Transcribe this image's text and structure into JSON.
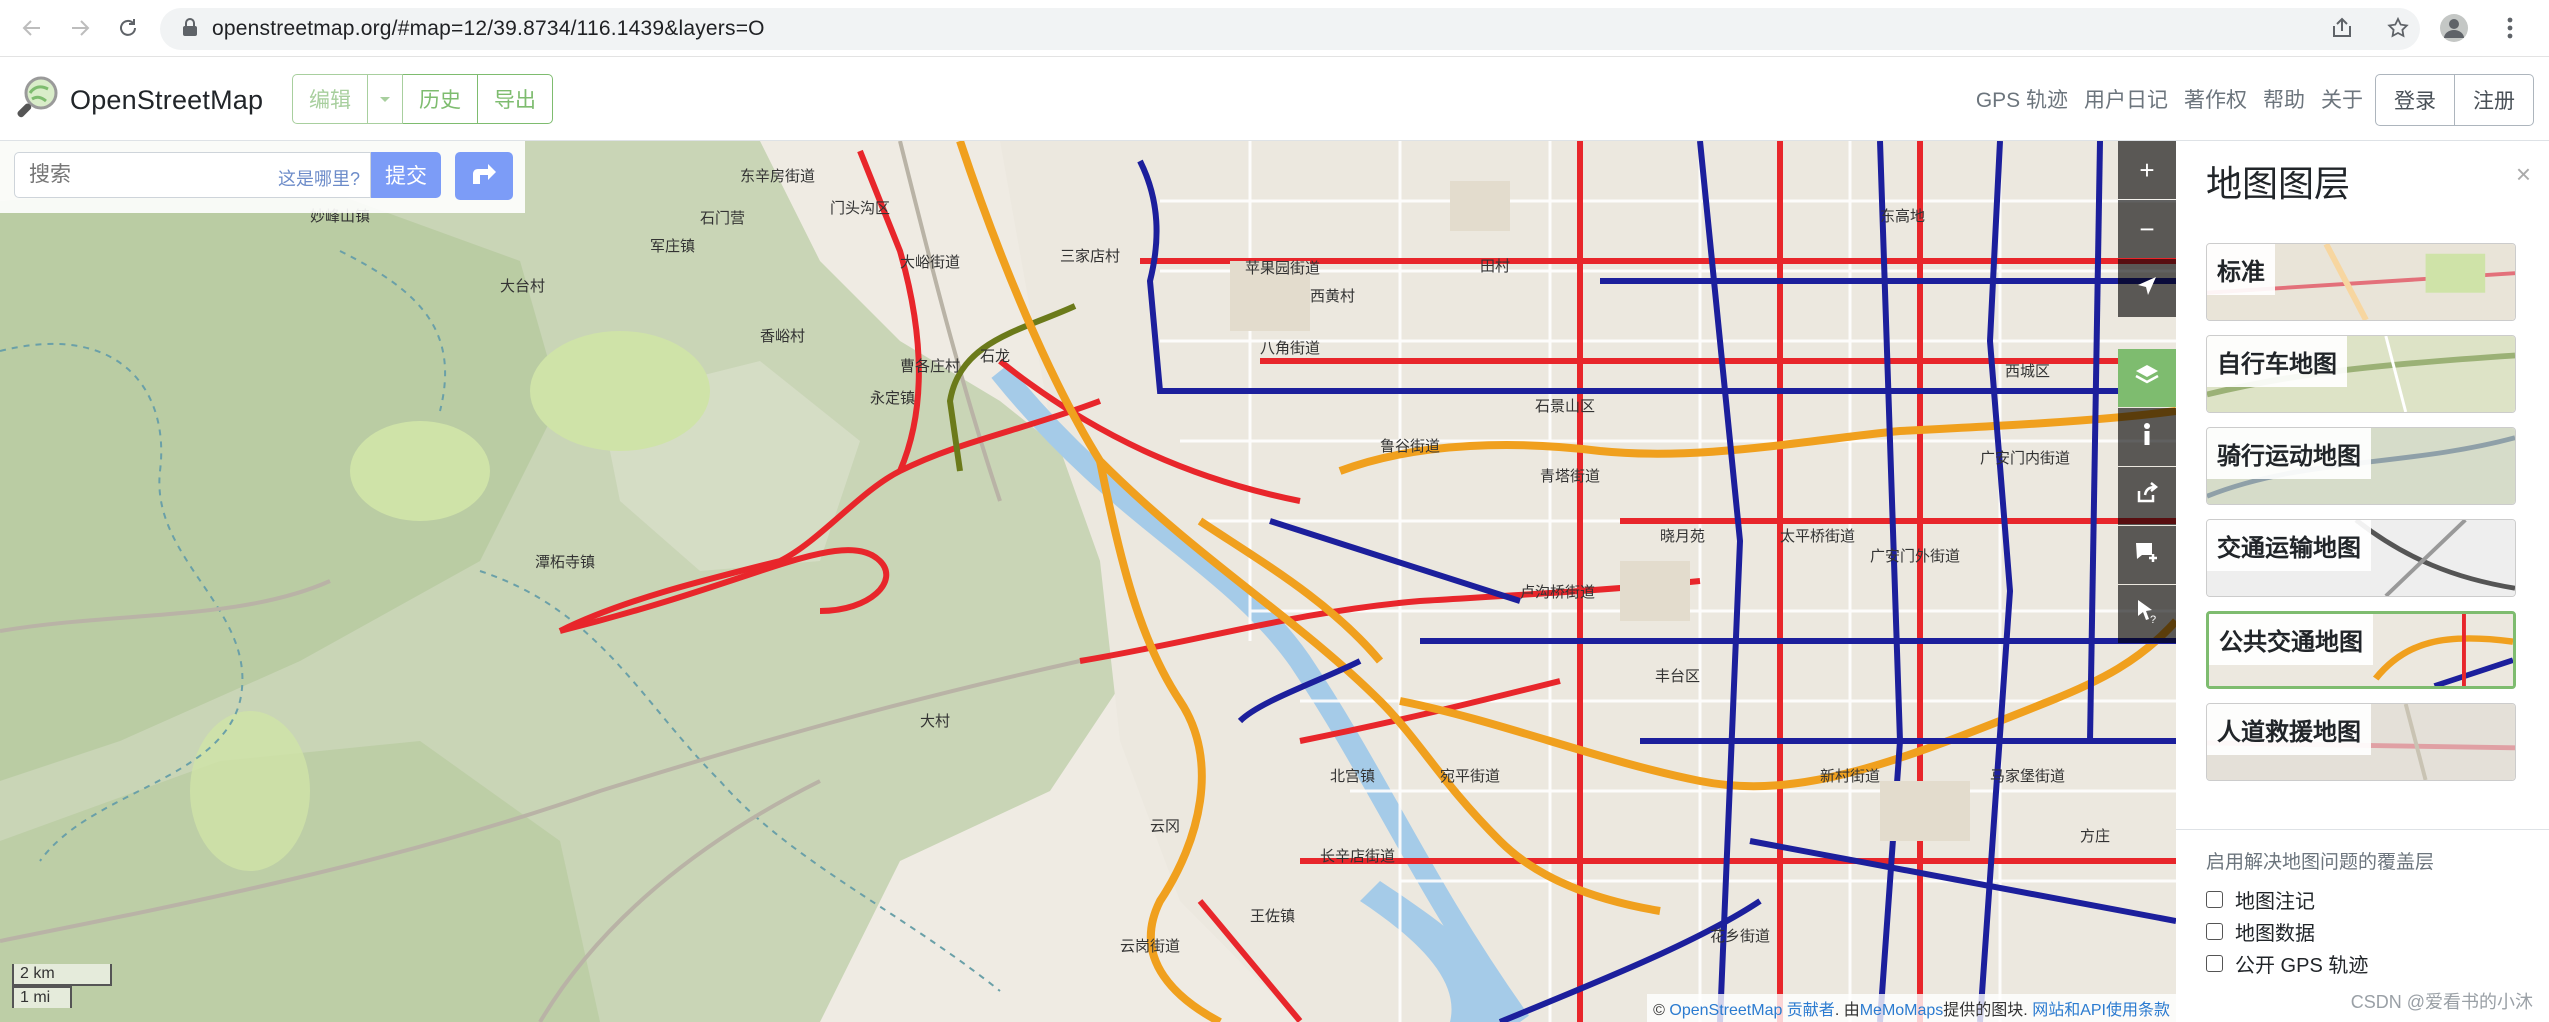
{
  "browser": {
    "url": "openstreetmap.org/#map=12/39.8734/116.1439&layers=O"
  },
  "header": {
    "brand": "OpenStreetMap",
    "edit": "编辑",
    "history": "历史",
    "export": "导出",
    "links": [
      "GPS 轨迹",
      "用户日记",
      "著作权",
      "帮助",
      "关于"
    ],
    "login": "登录",
    "signup": "注册"
  },
  "search": {
    "placeholder": "搜索",
    "where_link": "这是哪里?",
    "submit": "提交"
  },
  "map": {
    "scale_km": "2 km",
    "scale_mi": "1 mi",
    "attribution_prefix": "© ",
    "attribution_osm": "OpenStreetMap 贡献者",
    "attribution_mid": ". 由",
    "attribution_memo": "MeMoMaps",
    "attribution_tiles": "提供的图块. ",
    "attribution_terms": "网站和API使用条款",
    "colors": {
      "bus_route": "#1c1f9c",
      "rail": "#e8262b",
      "metro": "#f0a01e",
      "water": "#a5cbe8",
      "forest": "#b8cf9a",
      "urban": "#efebe3"
    },
    "place_labels": [
      "门头沟区",
      "石景山区",
      "丰台区",
      "西城区",
      "大峪街道",
      "苹果园街道",
      "八角街道",
      "鲁谷街道",
      "卢沟桥街道",
      "宛平街道",
      "长辛店街道",
      "云岗街道",
      "王佐镇",
      "永定镇",
      "潭柘寺镇",
      "军庄镇",
      "石门营",
      "大台村",
      "香峪村",
      "三家店村",
      "妙峰山镇",
      "晓月苑",
      "太平桥街道",
      "新村街道",
      "东辛房街道",
      "石龙",
      "曹各庄村",
      "大村",
      "西黄村",
      "田村",
      "北宫镇",
      "青塔街道",
      "花乡街道",
      "马家堡街道",
      "东高地",
      "云冈",
      "方庄",
      "广安门内街道",
      "广安门外街道"
    ]
  },
  "sidebar": {
    "title": "地图图层",
    "close": "×",
    "layers": [
      {
        "label": "标准",
        "active": false
      },
      {
        "label": "自行车地图",
        "active": false
      },
      {
        "label": "骑行运动地图",
        "active": false
      },
      {
        "label": "交通运输地图",
        "active": false
      },
      {
        "label": "公共交通地图",
        "active": true
      },
      {
        "label": "人道救援地图",
        "active": false
      }
    ],
    "overlay_title": "启用解决地图问题的覆盖层",
    "overlays": [
      "地图注记",
      "地图数据",
      "公开 GPS 轨迹"
    ]
  },
  "watermark": "CSDN @爱看书的小沐"
}
